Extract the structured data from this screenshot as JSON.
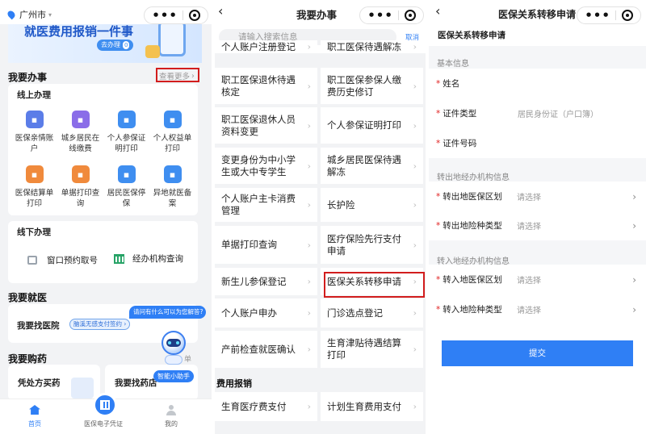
{
  "p1": {
    "city": "广州市",
    "banner_text": "就医费用报销一件事",
    "banner_btn": "去办理",
    "banner_badge": "0",
    "section_todo": "我要办事",
    "see_more": "查看更多",
    "online_title": "线上办理",
    "online_items": [
      {
        "label": "医保亲情账户",
        "icon": "family-icon",
        "color": "#5b7de8"
      },
      {
        "label": "城乡居民在线缴费",
        "icon": "person-icon",
        "color": "#8a6de8"
      },
      {
        "label": "个人参保证明打印",
        "icon": "document-icon",
        "color": "#3f8ef0"
      },
      {
        "label": "个人权益单打印",
        "icon": "printer-icon",
        "color": "#3f8ef0"
      },
      {
        "label": "医保结算单打印",
        "icon": "receipt-icon",
        "color": "#f08a3c"
      },
      {
        "label": "单据打印查询",
        "icon": "print-query-icon",
        "color": "#f08a3c"
      },
      {
        "label": "居民医保停保",
        "icon": "card-icon",
        "color": "#3f8ef0"
      },
      {
        "label": "异地就医备案",
        "icon": "shield-icon",
        "color": "#3f8ef0"
      }
    ],
    "offline_title": "线下办理",
    "offline_items": [
      {
        "label": "窗口预约取号",
        "icon": "calendar-icon"
      },
      {
        "label": "经办机构查询",
        "icon": "building-icon"
      }
    ],
    "section_doctor": "我要就医",
    "find_hospital": "我要找医院",
    "find_hospital_tag": "脑溪无感支付签约",
    "bot_bubble": "请问有什么可以为您解答?",
    "section_drug": "我要购药",
    "drug_left": "凭处方买药",
    "drug_right": "我要找药店",
    "assistant_label": "智能小助手",
    "side_tag": "单",
    "nav": [
      {
        "label": "首页",
        "active": true
      },
      {
        "label": "医保电子凭证",
        "active": false
      },
      {
        "label": "我的",
        "active": false
      }
    ]
  },
  "p2": {
    "title": "我要办事",
    "search_placeholder": "请输入搜索信息",
    "cancel": "取消",
    "rows": [
      [
        "个人账户注册登记",
        "职工医保待遇解冻"
      ],
      [
        "职工医保退休待遇核定",
        "职工医保参保人缴费历史修订"
      ],
      [
        "职工医保退休人员资料变更",
        "个人参保证明打印"
      ],
      [
        "变更身份为中小学生或大中专学生",
        "城乡居民医保待遇解冻"
      ],
      [
        "个人账户主卡消费管理",
        "长护险"
      ],
      [
        "单据打印查询",
        "医疗保险先行支付申请"
      ],
      [
        "新生儿参保登记",
        "医保关系转移申请"
      ],
      [
        "个人账户申办",
        "门诊选点登记"
      ],
      [
        "产前检查就医确认",
        "生育津贴待遇结算打印"
      ]
    ],
    "fee_title": "费用报销",
    "fee_rows": [
      [
        "生育医疗费支付",
        "计划生育费用支付"
      ]
    ]
  },
  "p3": {
    "title": "医保关系转移申请",
    "header": "医保关系转移申请",
    "basic_info": "基本信息",
    "name_label": "姓名",
    "cert_type_label": "证件类型",
    "cert_type_value": "居民身份证（户口簿）",
    "cert_no_label": "证件号码",
    "out_group": "转出地经办机构信息",
    "out_region_label": "转出地医保区划",
    "out_type_label": "转出地险种类型",
    "in_group": "转入地经办机构信息",
    "in_region_label": "转入地医保区划",
    "in_type_label": "转入地险种类型",
    "select_placeholder": "请选择",
    "submit": "提交",
    "accent": "#2f7ff5"
  }
}
